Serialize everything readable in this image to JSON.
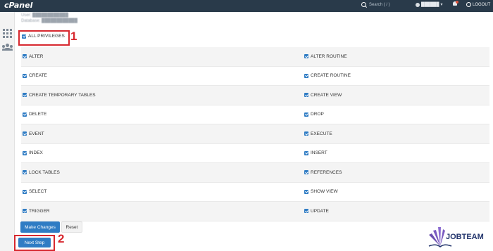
{
  "app": {
    "logo": "cPanel"
  },
  "topbar": {
    "search_placeholder": "Search ( / )",
    "username": "██████",
    "logout_label": "LOGOUT"
  },
  "header": {
    "user_line": "User: ████████████",
    "db_line": "Database: ████████████"
  },
  "privileges": {
    "all_label": "ALL PRIVILEGES",
    "left": [
      "ALTER",
      "CREATE",
      "CREATE TEMPORARY TABLES",
      "DELETE",
      "EVENT",
      "INDEX",
      "LOCK TABLES",
      "SELECT",
      "TRIGGER"
    ],
    "right": [
      "ALTER ROUTINE",
      "CREATE ROUTINE",
      "CREATE VIEW",
      "DROP",
      "EXECUTE",
      "INSERT",
      "REFERENCES",
      "SHOW VIEW",
      "UPDATE"
    ]
  },
  "actions": {
    "make_changes": "Make Changes",
    "reset": "Reset",
    "next_step": "Next Step"
  },
  "annotations": {
    "step1": "1",
    "step2": "2"
  },
  "watermark": {
    "brand": "JOBTEAM"
  },
  "colors": {
    "topbar": "#293a4a",
    "accent": "#2f7cc4",
    "highlight": "#d7282f",
    "brand": "#22346c"
  }
}
